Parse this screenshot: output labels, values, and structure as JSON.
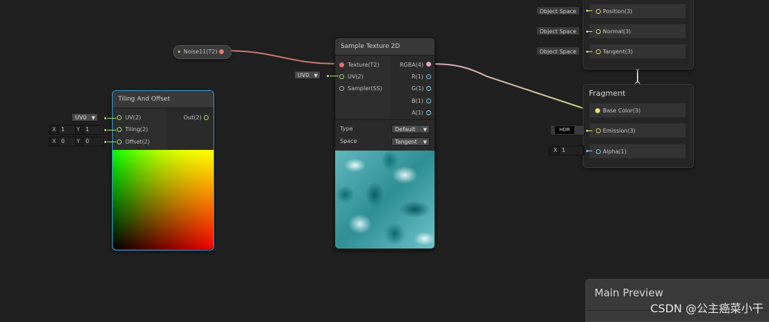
{
  "noise_node": {
    "label": "Noise11(T2)"
  },
  "tiling_node": {
    "title": "Tiling And Offset",
    "inputs": {
      "uv": "UV(2)",
      "tiling": "Tiling(2)",
      "offset": "Offset(2)"
    },
    "output": "Out(2)",
    "uv_dropdown": "UV0",
    "tiling_x_label": "X",
    "tiling_x": "1",
    "tiling_y_label": "Y",
    "tiling_y": "1",
    "offset_x_label": "X",
    "offset_x": "0",
    "offset_y_label": "Y",
    "offset_y": "0"
  },
  "sample_node": {
    "title": "Sample Texture 2D",
    "inputs": {
      "texture": "Texture(T2)",
      "uv": "UV(2)",
      "sampler": "Sampler(SS)"
    },
    "outputs": {
      "rgba": "RGBA(4)",
      "r": "R(1)",
      "g": "G(1)",
      "b": "B(1)",
      "a": "A(1)"
    },
    "uv_dropdown": "UV0",
    "type_label": "Type",
    "type_value": "Default",
    "space_label": "Space",
    "space_value": "Tangent"
  },
  "vertex_block": {
    "rows": [
      {
        "space": "Object Space",
        "label": "Position(3)"
      },
      {
        "space": "Object Space",
        "label": "Normal(3)"
      },
      {
        "space": "Object Space",
        "label": "Tangent(3)"
      }
    ]
  },
  "fragment_block": {
    "title": "Fragment",
    "base_color": "Base Color(3)",
    "emission": "Emission(3)",
    "emission_tag": "HDR",
    "alpha": "Alpha(1)",
    "alpha_x_label": "X",
    "alpha_value": "1"
  },
  "main_preview": {
    "title": "Main Preview"
  },
  "watermark": "CSDN @公主癌菜小干",
  "colors": {
    "background": "#202020",
    "selection_outline": "#3aa0d8",
    "texture_wire": "#d27c72",
    "color_wire": "#b9d98a",
    "vector2_port": "#a8e06a",
    "float_port": "#7ed4e6"
  }
}
